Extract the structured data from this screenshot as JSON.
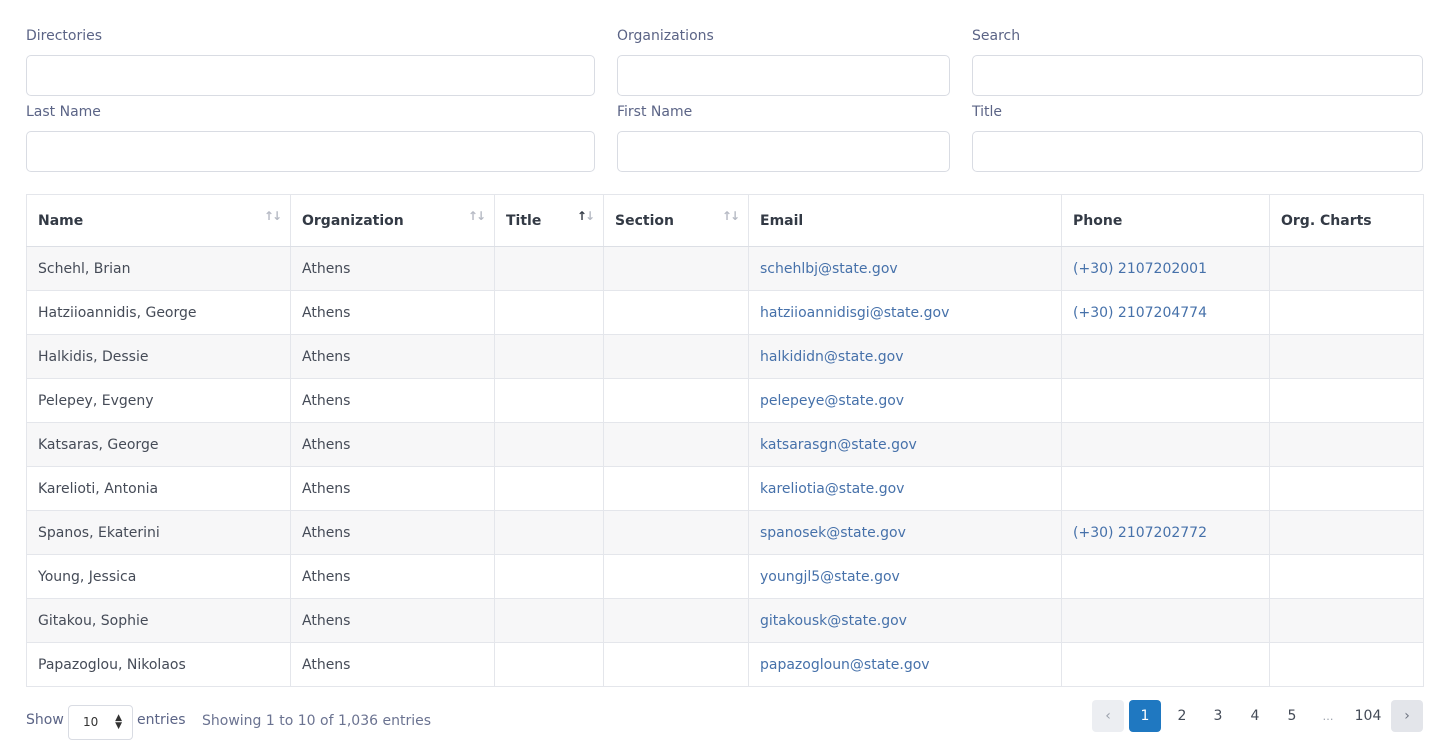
{
  "filters": {
    "directories_label": "Directories",
    "organizations_label": "Organizations",
    "search_label": "Search",
    "last_name_label": "Last Name",
    "first_name_label": "First Name",
    "title_label": "Title"
  },
  "table": {
    "headers": {
      "name": "Name",
      "organization": "Organization",
      "title": "Title",
      "section": "Section",
      "email": "Email",
      "phone": "Phone",
      "org_charts": "Org. Charts"
    },
    "rows": [
      {
        "name": "Schehl, Brian",
        "organization": "Athens",
        "title": "",
        "section": "",
        "email": "schehlbj@state.gov",
        "phone": "(+30) 2107202001",
        "org_charts": ""
      },
      {
        "name": "Hatziioannidis, George",
        "organization": "Athens",
        "title": "",
        "section": "",
        "email": "hatziioannidisgi@state.gov",
        "phone": "(+30) 2107204774",
        "org_charts": ""
      },
      {
        "name": "Halkidis, Dessie",
        "organization": "Athens",
        "title": "",
        "section": "",
        "email": "halkididn@state.gov",
        "phone": "",
        "org_charts": ""
      },
      {
        "name": "Pelepey, Evgeny",
        "organization": "Athens",
        "title": "",
        "section": "",
        "email": "pelepeye@state.gov",
        "phone": "",
        "org_charts": ""
      },
      {
        "name": "Katsaras, George",
        "organization": "Athens",
        "title": "",
        "section": "",
        "email": "katsarasgn@state.gov",
        "phone": "",
        "org_charts": ""
      },
      {
        "name": "Karelioti, Antonia",
        "organization": "Athens",
        "title": "",
        "section": "",
        "email": "kareliotia@state.gov",
        "phone": "",
        "org_charts": ""
      },
      {
        "name": "Spanos, Ekaterini",
        "organization": "Athens",
        "title": "",
        "section": "",
        "email": "spanosek@state.gov",
        "phone": "(+30) 2107202772",
        "org_charts": ""
      },
      {
        "name": "Young, Jessica",
        "organization": "Athens",
        "title": "",
        "section": "",
        "email": "youngjl5@state.gov",
        "phone": "",
        "org_charts": ""
      },
      {
        "name": "Gitakou, Sophie",
        "organization": "Athens",
        "title": "",
        "section": "",
        "email": "gitakousk@state.gov",
        "phone": "",
        "org_charts": ""
      },
      {
        "name": "Papazoglou, Nikolaos",
        "organization": "Athens",
        "title": "",
        "section": "",
        "email": "papazogloun@state.gov",
        "phone": "",
        "org_charts": ""
      }
    ]
  },
  "footer": {
    "show_label": "Show",
    "entries_value": "10",
    "entries_label": "entries",
    "info": "Showing 1 to 10 of 1,036 entries"
  },
  "pagination": {
    "prev_icon": "chevron-left-icon",
    "next_icon": "chevron-right-icon",
    "prev_glyph": "‹",
    "next_glyph": "›",
    "pages": [
      "1",
      "2",
      "3",
      "4",
      "5"
    ],
    "ellipsis": "…",
    "last": "104",
    "active_color": "#1f78c1"
  },
  "colors": {
    "link": "#4671aa",
    "label": "#5b6486"
  }
}
